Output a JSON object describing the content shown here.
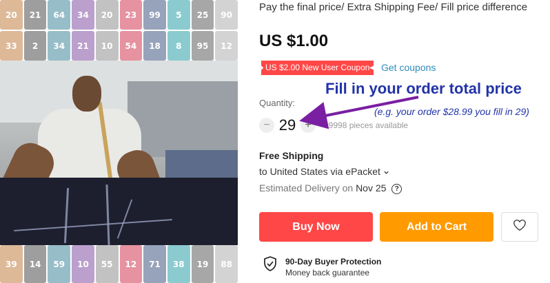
{
  "product": {
    "title": "Pay the final price/ Extra Shipping Fee/ Fill price difference",
    "price": "US $1.00"
  },
  "coupon": {
    "badge": "US $2.00 New User Coupon",
    "link": "Get coupons"
  },
  "quantity": {
    "label": "Quantity:",
    "minus": "−",
    "value": "29",
    "plus": "+",
    "available": "99998 pieces available"
  },
  "annotation": {
    "main": "Fill in your order total price",
    "sub": "(e.g. your order $28.99 you fill in 29)"
  },
  "shipping": {
    "title": "Free Shipping",
    "via": "to United States via ePacket",
    "delivery_prefix": "Estimated Delivery on",
    "delivery_date": "Nov 25"
  },
  "actions": {
    "buy_now": "Buy Now",
    "add_to_cart": "Add to Cart"
  },
  "protection": {
    "title": "90-Day Buyer Protection",
    "subtitle": "Money back guarantee"
  },
  "thumbnails": {
    "top_row": [
      "20",
      "21",
      "64",
      "34",
      "20",
      "23",
      "99",
      "5",
      "25",
      "90",
      "33",
      "2",
      "34",
      "21",
      "10",
      "54",
      "18",
      "8",
      "95",
      "12"
    ],
    "bottom_row": [
      "39",
      "14",
      "59",
      "10",
      "55",
      "12",
      "71",
      "38",
      "19",
      "88"
    ]
  },
  "colors": {
    "buy_now": "#ff4747",
    "add_to_cart": "#ff9a00",
    "coupon": "#ff4747",
    "link": "#2e8bbe",
    "annotation": "#2233a8",
    "arrow": "#7a1fa2"
  },
  "icons": {
    "heart": "heart-icon",
    "shield": "shield-check-icon",
    "help": "question-circle-icon",
    "chevron": "chevron-down-icon"
  }
}
